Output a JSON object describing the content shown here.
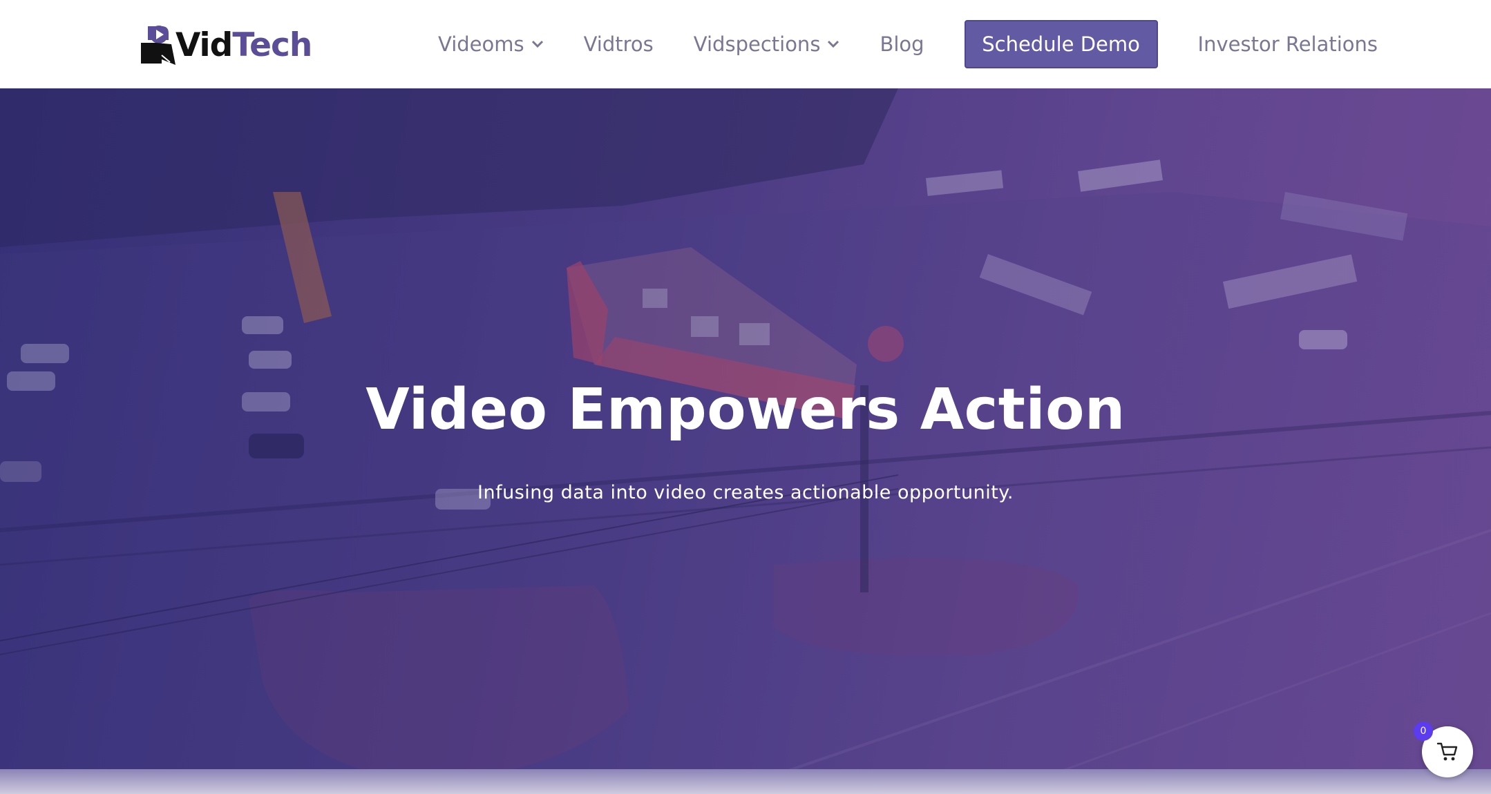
{
  "brand": {
    "name_part1": "Vid",
    "name_part2": "Tech",
    "logo_icon": "play-camera-icon",
    "colors": {
      "dark": "#111111",
      "accent": "#5c4d99"
    }
  },
  "nav": {
    "items": [
      {
        "label": "Videoms",
        "has_dropdown": true
      },
      {
        "label": "Vidtros",
        "has_dropdown": false
      },
      {
        "label": "Vidspections",
        "has_dropdown": true
      },
      {
        "label": "Blog",
        "has_dropdown": false
      }
    ],
    "cta_label": "Schedule Demo",
    "investor_label": "Investor Relations",
    "colors": {
      "link": "#7a7795",
      "cta_bg": "#635aa4"
    }
  },
  "hero": {
    "title": "Video Empowers Action",
    "subtitle": "Infusing data into video creates actionable opportunity.",
    "background": "aerial-view-gas-station-image"
  },
  "cart": {
    "icon": "shopping-cart-icon",
    "count": "0",
    "badge_color": "#5b3cf0"
  }
}
